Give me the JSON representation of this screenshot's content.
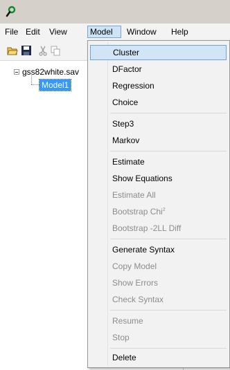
{
  "menubar": {
    "items": [
      {
        "label": "File"
      },
      {
        "label": "Edit"
      },
      {
        "label": "View"
      },
      {
        "label": "Model",
        "active": true
      },
      {
        "label": "Window"
      },
      {
        "label": "Help"
      }
    ]
  },
  "toolbar": {
    "buttons": [
      "open-folder-icon",
      "save-icon",
      "cut-icon",
      "copy-icon"
    ]
  },
  "tree": {
    "root_label": "gss82white.sav",
    "child_label": "Model1"
  },
  "model_menu": {
    "groups": [
      [
        {
          "label": "Cluster",
          "enabled": true,
          "highlighted": true
        },
        {
          "label": "DFactor",
          "enabled": true
        },
        {
          "label": "Regression",
          "enabled": true
        },
        {
          "label": "Choice",
          "enabled": true
        }
      ],
      [
        {
          "label": "Step3",
          "enabled": true
        },
        {
          "label": "Markov",
          "enabled": true
        }
      ],
      [
        {
          "label": "Estimate",
          "enabled": true
        },
        {
          "label": "Show Equations",
          "enabled": true
        },
        {
          "label": "Estimate All",
          "enabled": false
        },
        {
          "label": "Bootstrap Chi",
          "superscript": "2",
          "enabled": false
        },
        {
          "label": "Bootstrap -2LL Diff",
          "enabled": false
        }
      ],
      [
        {
          "label": "Generate Syntax",
          "enabled": true
        },
        {
          "label": "Copy Model",
          "enabled": false
        },
        {
          "label": "Show Errors",
          "enabled": false
        },
        {
          "label": "Check Syntax",
          "enabled": false
        }
      ],
      [
        {
          "label": "Resume",
          "enabled": false
        },
        {
          "label": "Stop",
          "enabled": false
        }
      ],
      [
        {
          "label": "Delete",
          "enabled": true
        }
      ]
    ]
  },
  "colors": {
    "selection": "#3399ff",
    "menu_hover": "#d1e5f6",
    "disabled_text": "#8c8c8c"
  }
}
